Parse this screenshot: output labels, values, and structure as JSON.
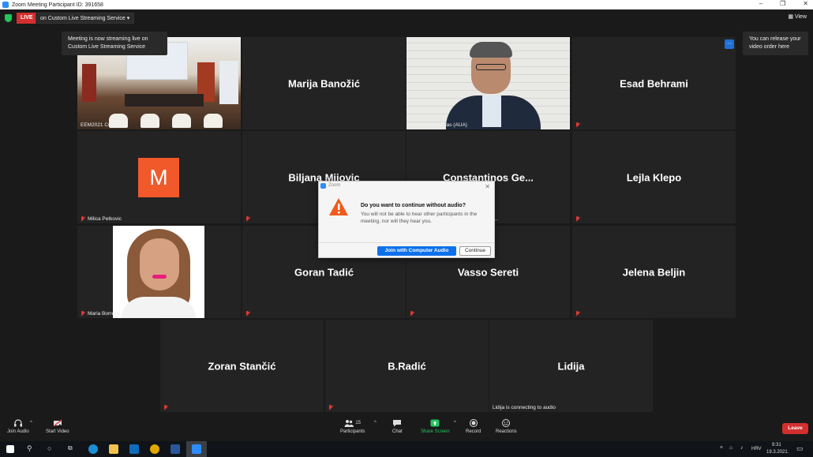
{
  "window": {
    "title": "Zoom Meeting Participant ID: 391658"
  },
  "topbar": {
    "live_label": "LIVE",
    "stream_label": "on Custom Live Streaming Service",
    "view_label": "View"
  },
  "tooltips": {
    "streaming": "Meeting is now streaming live on Custom Live Streaming Service",
    "release_order": "You can release your video order here"
  },
  "tiles": [
    {
      "name": "",
      "label": "EEM2021 Congress"
    },
    {
      "name": "Marija Banožić",
      "label": ""
    },
    {
      "name": "",
      "label": "Apostolis Koutinas (AUA)"
    },
    {
      "name": "Esad Behrami",
      "label": ""
    },
    {
      "name": "",
      "label": "Milica Petkovic",
      "avatar_letter": "M"
    },
    {
      "name": "Biljana Mijovic",
      "label": ""
    },
    {
      "name": "Constantinos  Ge...",
      "label": "to ..."
    },
    {
      "name": "Lejla Klepo",
      "label": ""
    },
    {
      "name": "",
      "label": "Maria Borrego"
    },
    {
      "name": "Goran Tadić",
      "label": ""
    },
    {
      "name": "Vasso Sereti",
      "label": ""
    },
    {
      "name": "Jelena Beljin",
      "label": ""
    },
    {
      "name": "Zoran Stančić",
      "label": ""
    },
    {
      "name": "B.Radić",
      "label": ""
    },
    {
      "name": "Lidija",
      "label": "Lidija is connecting to audio"
    }
  ],
  "dialog": {
    "app_name": "Zoom",
    "title": "Do you want to continue without audio?",
    "body": "You will not be able to hear other participants in the meeting, nor will they hear you.",
    "primary_label": "Join with Computer Audio",
    "secondary_label": "Continue"
  },
  "toolbar": {
    "join_audio": "Join Audio",
    "start_video": "Start Video",
    "participants": "Participants",
    "participants_count": "15",
    "chat": "Chat",
    "share_screen": "Share Screen",
    "record": "Record",
    "reactions": "Reactions",
    "leave": "Leave"
  },
  "taskbar": {
    "language": "HRV",
    "time": "9:31",
    "date": "19.3.2021."
  },
  "colors": {
    "live_red": "#d32f2f",
    "zoom_blue": "#0e71eb",
    "share_green": "#22c55e",
    "active_speaker": "#c9d74b",
    "avatar_orange": "#f1592a"
  }
}
